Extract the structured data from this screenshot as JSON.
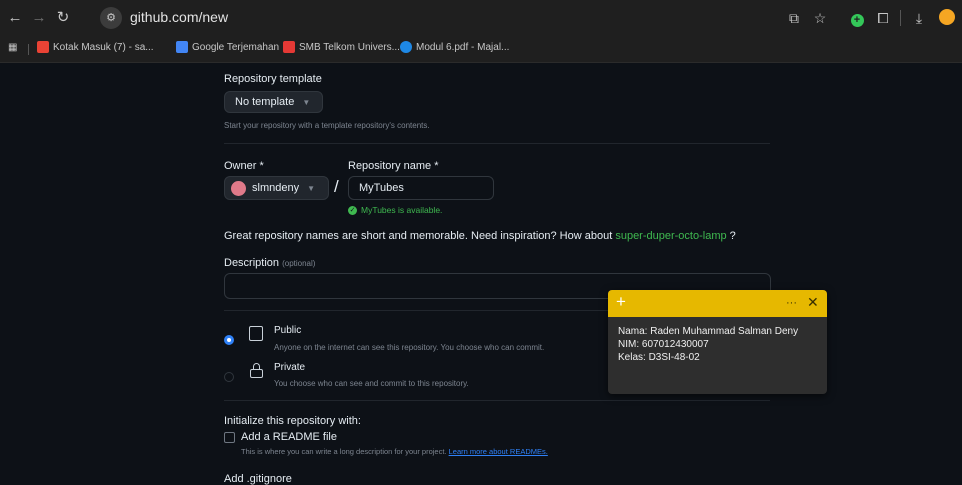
{
  "browser": {
    "url": "github.com/new",
    "bookmarks": [
      {
        "label": "Kotak Masuk (7) - sa...",
        "icon": "gmail-icon",
        "color": "#ea4335"
      },
      {
        "label": "Google Terjemahan",
        "icon": "google-translate-icon",
        "color": "#4285f4"
      },
      {
        "label": "SMB Telkom Univers...",
        "icon": "telkom-icon",
        "color": "#e53935"
      },
      {
        "label": "Modul 6.pdf - Majal...",
        "icon": "modul-icon",
        "color": "#1e88e5"
      }
    ]
  },
  "form": {
    "template_heading": "Repository template",
    "template_select": "No template",
    "template_help": "Start your repository with a template repository's contents.",
    "owner_label": "Owner *",
    "owner_value": "slmndeny",
    "slash": "/",
    "repo_label": "Repository name *",
    "repo_value": "MyTubes",
    "available_msg": "MyTubes is available.",
    "inspiration_text": "Great repository names are short and memorable. Need inspiration? How about",
    "inspiration_link": "super-duper-octo-lamp",
    "inspiration_end": "?",
    "description_label": "Description",
    "description_optional": "(optional)",
    "description_value": "",
    "public_label": "Public",
    "public_desc": "Anyone on the internet can see this repository. You choose who can commit.",
    "private_label": "Private",
    "private_desc": "You choose who can see and commit to this repository.",
    "init_heading": "Initialize this repository with:",
    "readme_label": "Add a README file",
    "readme_desc": "This is where you can write a long description for your project.",
    "readme_link": "Learn more about READMEs.",
    "gitignore_heading": "Add .gitignore"
  },
  "sticky_note": {
    "add_glyph": "+",
    "menu_glyph": "···",
    "close_glyph": "✕",
    "line1": "Nama: Raden Muhammad Salman Deny",
    "line2": "NIM: 607012430007",
    "line3": "Kelas: D3SI-48-02"
  },
  "colors": {
    "accent_link": "#3fb950",
    "radio_blue": "#2f81f7",
    "sticky_yellow": "#e6b800"
  }
}
